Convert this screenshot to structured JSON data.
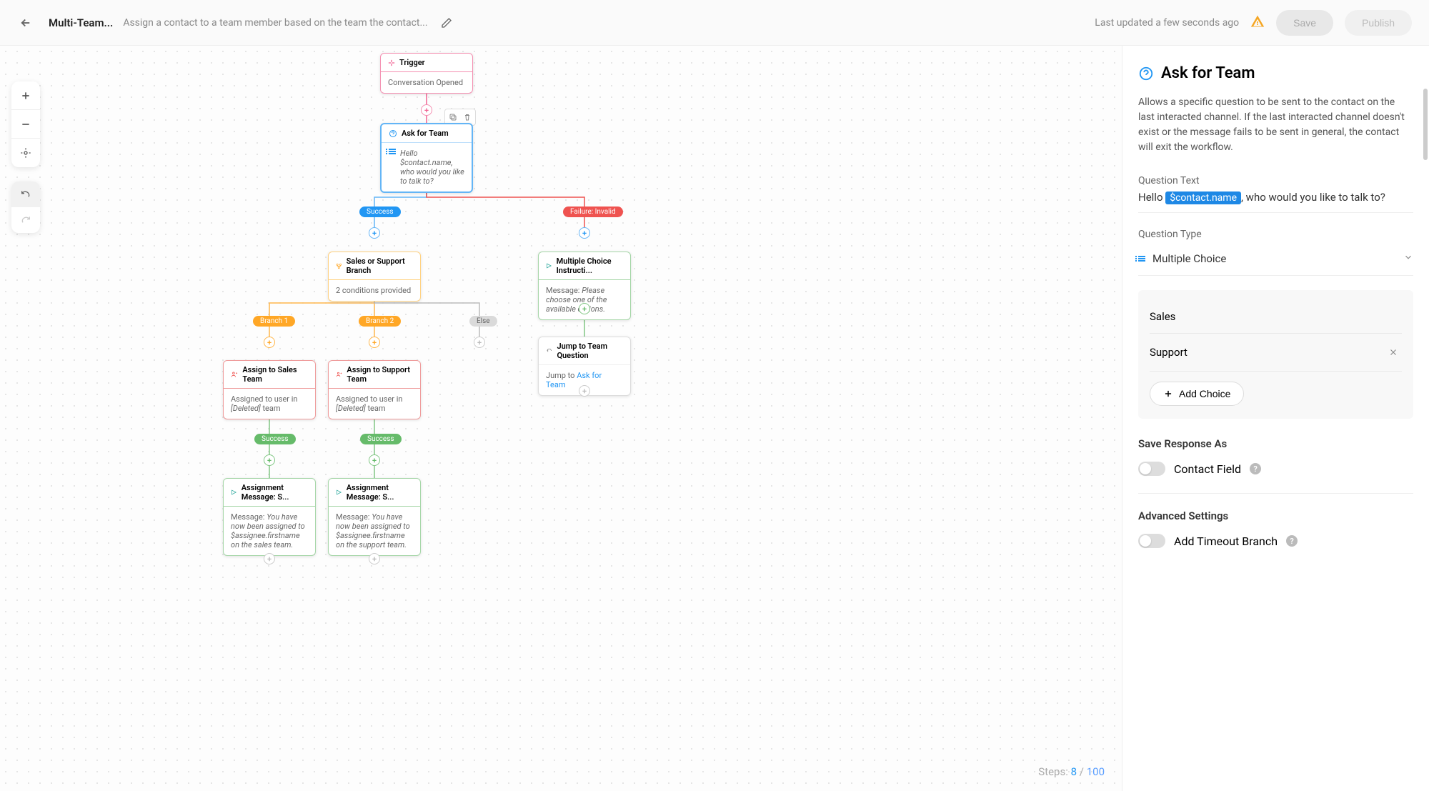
{
  "header": {
    "title": "Multi-Team...",
    "subtitle": "Assign a contact to a team member based on the team the contact...",
    "last_updated": "Last updated a few seconds ago",
    "save": "Save",
    "publish": "Publish"
  },
  "steps": {
    "label": "Steps:",
    "current": "8",
    "sep": "/",
    "total": "100"
  },
  "nodes": {
    "trigger": {
      "title": "Trigger",
      "body": "Conversation Opened"
    },
    "ask": {
      "title": "Ask for Team",
      "body": "Hello $contact.name, who would you like to talk to?"
    },
    "branch": {
      "title": "Sales or Support Branch",
      "body": "2 conditions provided"
    },
    "mci": {
      "title": "Multiple Choice Instructi...",
      "body_label": "Message: ",
      "body_italic": "Please choose one of the available options."
    },
    "assign1": {
      "title": "Assign to Sales Team",
      "body_pre": "Assigned to user in ",
      "body_italic": "[Deleted]",
      "body_post": " team"
    },
    "assign2": {
      "title": "Assign to Support Team",
      "body_pre": "Assigned to user in ",
      "body_italic": "[Deleted]",
      "body_post": " team"
    },
    "jump": {
      "title": "Jump to Team Question",
      "body_pre": "Jump to ",
      "body_link": "Ask for Team"
    },
    "msg1": {
      "title": "Assignment Message: S...",
      "body_label": "Message: ",
      "body_italic": "You have now been assigned to $assignee.firstname on the sales team."
    },
    "msg2": {
      "title": "Assignment Message: S...",
      "body_label": "Message: ",
      "body_italic": "You have now been assigned to $assignee.firstname on the support team."
    }
  },
  "pills": {
    "success1": "Success",
    "failure": "Failure: Invalid",
    "b1": "Branch 1",
    "b2": "Branch 2",
    "else": "Else",
    "success2": "Success",
    "success3": "Success"
  },
  "sidebar": {
    "title": "Ask for Team",
    "desc": "Allows a specific question to be sent to the contact on the last interacted channel. If the last interacted channel doesn't exist or the message fails to be sent in general, the contact will exit the workflow.",
    "qtext_label": "Question Text",
    "qtext_pre": "Hello ",
    "qtext_chip": "$contact.name",
    "qtext_post": ",  who would you like to talk to?",
    "qtype_label": "Question Type",
    "qtype_value": "Multiple Choice",
    "choices": [
      "Sales",
      "Support"
    ],
    "add_choice": "Add Choice",
    "save_as": "Save Response As",
    "save_as_opt": "Contact Field",
    "adv": "Advanced Settings",
    "adv_opt": "Add Timeout Branch"
  }
}
